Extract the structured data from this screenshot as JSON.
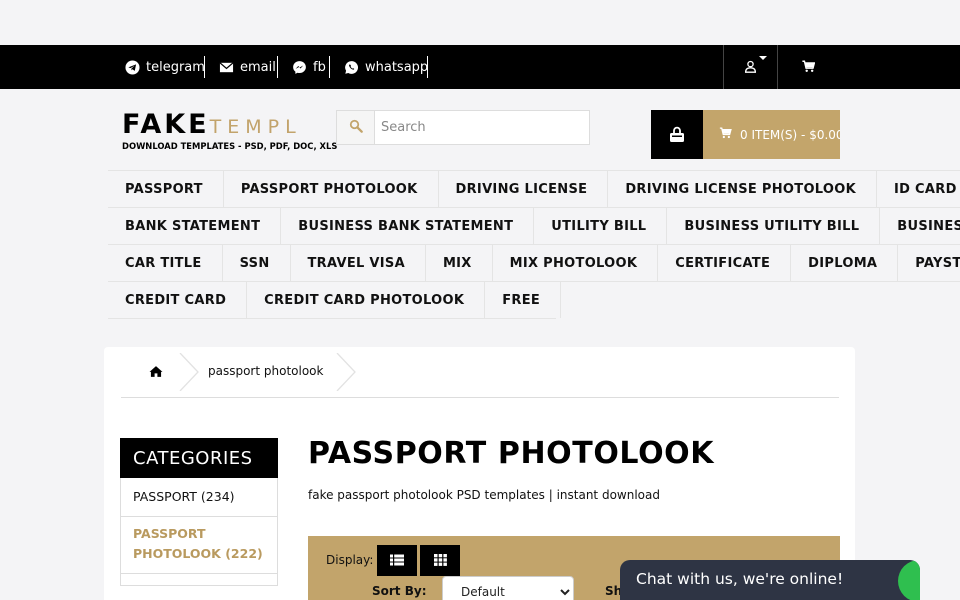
{
  "topbar": {
    "contacts": [
      {
        "label": "telegram",
        "icon": "telegram-icon"
      },
      {
        "label": "email",
        "icon": "email-icon"
      },
      {
        "label": "fb",
        "icon": "messenger-icon"
      },
      {
        "label": "whatsapp",
        "icon": "whatsapp-icon"
      }
    ],
    "account_icon": "user-icon",
    "cart_icon": "cart-icon"
  },
  "logo": {
    "line1_dark": "FAKE",
    "line1_gold": "TEMPL",
    "line2": "DOWNLOAD TEMPLATES - PSD, PDF, DOC, XLS"
  },
  "search": {
    "placeholder": "Search",
    "value": ""
  },
  "cart": {
    "summary": "0 ITEM(S) - $0.00"
  },
  "menu": {
    "rows": [
      [
        "PASSPORT",
        "PASSPORT PHOTOLOOK",
        "DRIVING LICENSE",
        "DRIVING LICENSE PHOTOLOOK",
        "ID CARD"
      ],
      [
        "BANK STATEMENT",
        "BUSINESS BANK STATEMENT",
        "UTILITY BILL",
        "BUSINESS UTILITY BILL",
        "BUSINESS"
      ],
      [
        "CAR TITLE",
        "SSN",
        "TRAVEL VISA",
        "MIX",
        "MIX PHOTOLOOK",
        "CERTIFICATE",
        "DIPLOMA",
        "PAYST"
      ],
      [
        "CREDIT CARD",
        "CREDIT CARD PHOTOLOOK",
        "FREE"
      ]
    ]
  },
  "breadcrumb": {
    "current": "passport photolook"
  },
  "sidebar": {
    "heading": "CATEGORIES",
    "items": [
      {
        "label": "PASSPORT (234)"
      },
      {
        "label": "PASSPORT PHOTOLOOK (222)",
        "active": true
      }
    ]
  },
  "main": {
    "title": "PASSPORT PHOTOLOOK",
    "description": "fake passport photolook PSD templates | instant download",
    "display_label": "Display:",
    "sort_label": "Sort By:",
    "sort_value": "Default",
    "show_label": "Sh"
  },
  "chat": {
    "text": "Chat with us, we're online!"
  },
  "colors": {
    "accent_gold": "#c2a46b",
    "topbar": "#000000",
    "chat_bg": "#2e3444",
    "chat_status": "#2fbf4f"
  }
}
